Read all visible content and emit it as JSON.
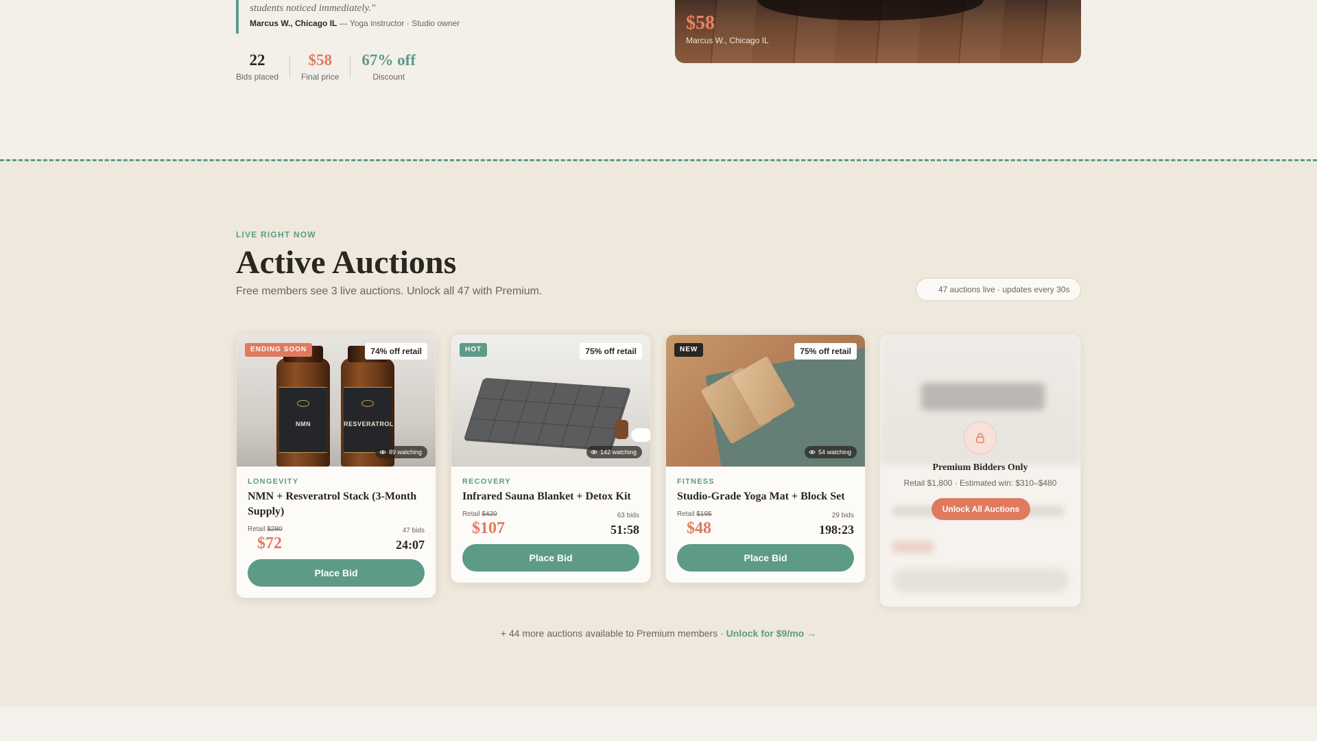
{
  "testimonial": {
    "quote_tail": "students noticed immediately.\"",
    "author_name": "Marcus W., Chicago IL",
    "author_meta": " — Yoga instructor · Studio owner",
    "stats": [
      {
        "value": "22",
        "label": "Bids placed",
        "color": "#2a2620"
      },
      {
        "value": "$58",
        "label": "Final price",
        "color": "#e07a5f"
      },
      {
        "value": "67% off",
        "label": "Discount",
        "color": "#5d9a88"
      }
    ],
    "image_price": "$58",
    "image_caption": "Marcus W., Chicago IL"
  },
  "auctions": {
    "eyebrow": "LIVE RIGHT NOW",
    "title": "Active Auctions",
    "subtitle": "Free members see 3 live auctions. Unlock all 47 with Premium.",
    "live_pill": "47 auctions live · updates every 30s",
    "cards": [
      {
        "badge": "ENDING SOON",
        "badge_color": "#e07a5f",
        "discount": "74% off retail",
        "watching": "89 watching",
        "category": "LONGEVITY",
        "title": "NMN + Resveratrol Stack (3-Month Supply)",
        "retail_label": "Retail",
        "retail_price": "$280",
        "bids": "47 bids",
        "current_price": "$72",
        "timer": "24:07",
        "button": "Place Bid",
        "bottle_labels": [
          "NMN",
          "RESVERATROL"
        ]
      },
      {
        "badge": "HOT",
        "badge_color": "#5d9a88",
        "discount": "75% off retail",
        "watching": "142 watching",
        "category": "RECOVERY",
        "title": "Infrared Sauna Blanket + Detox Kit",
        "retail_label": "Retail",
        "retail_price": "$420",
        "bids": "63 bids",
        "current_price": "$107",
        "timer": "51:58",
        "button": "Place Bid"
      },
      {
        "badge": "NEW",
        "badge_color": "#2a2620",
        "discount": "75% off retail",
        "watching": "54 watching",
        "category": "FITNESS",
        "title": "Studio-Grade Yoga Mat + Block Set",
        "retail_label": "Retail",
        "retail_price": "$195",
        "bids": "29 bids",
        "current_price": "$48",
        "timer": "198:23",
        "button": "Place Bid"
      }
    ],
    "locked": {
      "title": "Premium Bidders Only",
      "subtitle": "Retail $1,800 · Estimated win: $310–$480",
      "button": "Unlock All Auctions"
    },
    "more_text": "+ 44 more auctions available to Premium members · ",
    "more_link": "Unlock for $9/mo →"
  },
  "colors": {
    "accent_green": "#5d9a88",
    "accent_orange": "#e07a5f",
    "ink": "#2a2620"
  },
  "icons": [
    "eye-icon",
    "lock-icon"
  ]
}
